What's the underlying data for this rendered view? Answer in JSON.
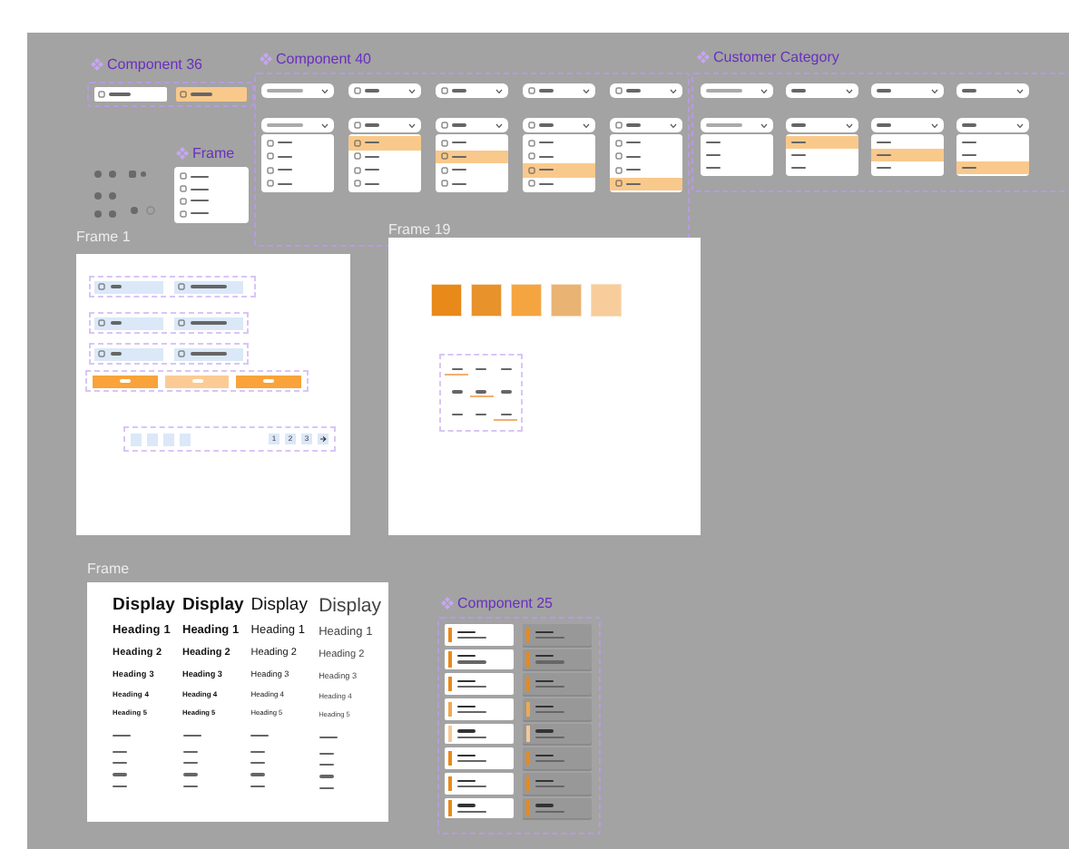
{
  "component_36": {
    "title": "Component 36",
    "buttons": [
      {
        "selected": false
      },
      {
        "selected": true
      }
    ]
  },
  "menu_frame": {
    "title": "Frame"
  },
  "component_40": {
    "title": "Component 40",
    "dropdowns": [
      {
        "options": [
          {
            "selected": false
          },
          {
            "selected": false
          },
          {
            "selected": false
          },
          {
            "selected": false
          }
        ]
      },
      {
        "options": [
          {
            "selected": true
          },
          {
            "selected": false
          },
          {
            "selected": false
          },
          {
            "selected": false
          }
        ]
      },
      {
        "options": [
          {
            "selected": false
          },
          {
            "selected": true
          },
          {
            "selected": false
          },
          {
            "selected": false
          }
        ]
      },
      {
        "options": [
          {
            "selected": false
          },
          {
            "selected": false
          },
          {
            "selected": true
          },
          {
            "selected": false
          }
        ]
      },
      {
        "options": [
          {
            "selected": false
          },
          {
            "selected": false
          },
          {
            "selected": false
          },
          {
            "selected": true
          }
        ]
      }
    ]
  },
  "customer_category": {
    "title": "Customer Category",
    "dropdowns": [
      {
        "options": [
          {
            "selected": false
          },
          {
            "selected": false
          },
          {
            "selected": false
          }
        ]
      },
      {
        "options": [
          {
            "selected": true
          },
          {
            "selected": false
          },
          {
            "selected": false
          }
        ]
      },
      {
        "options": [
          {
            "selected": false
          },
          {
            "selected": true
          },
          {
            "selected": false
          }
        ]
      },
      {
        "options": [
          {
            "selected": false
          },
          {
            "selected": false
          },
          {
            "selected": true
          }
        ]
      }
    ]
  },
  "frame_1": {
    "title": "Frame 1",
    "buttons": [
      {
        "disabled": false
      },
      {
        "disabled": true
      },
      {
        "disabled": false
      }
    ],
    "pages": [
      "1",
      "2",
      "3"
    ]
  },
  "frame_19": {
    "title": "Frame 19",
    "swatches": [
      {
        "color": "#e8891a"
      },
      {
        "color": "#e8922c"
      },
      {
        "color": "#f5a540"
      },
      {
        "color": "#e9b374"
      },
      {
        "color": "#f8cd9c"
      }
    ],
    "tab_rows": [
      {
        "tabs": [
          {
            "selected": true
          },
          {
            "selected": false
          },
          {
            "selected": false
          }
        ]
      },
      {
        "tabs": [
          {
            "selected": false
          },
          {
            "selected": true
          },
          {
            "selected": false
          }
        ]
      },
      {
        "tabs": [
          {
            "selected": false
          },
          {
            "selected": false
          },
          {
            "selected": true
          }
        ]
      }
    ]
  },
  "type_frame": {
    "title": "Frame",
    "columns": [
      {
        "kind": "heavy",
        "entries": [
          "Display",
          "Heading 1",
          "Heading 2",
          "Heading 3",
          "Heading 4",
          "Heading 5"
        ]
      },
      {
        "kind": "bold",
        "entries": [
          "Display",
          "Heading 1",
          "Heading 2",
          "Heading 3",
          "Heading 4",
          "Heading 5"
        ]
      },
      {
        "kind": "medium",
        "entries": [
          "Display",
          "Heading 1",
          "Heading 2",
          "Heading 3",
          "Heading 4",
          "Heading 5"
        ]
      },
      {
        "kind": "light",
        "entries": [
          "Display",
          "Heading 1",
          "Heading 2",
          "Heading 3",
          "Heading 4",
          "Heading 5"
        ]
      }
    ]
  },
  "component_25": {
    "title": "Component 25",
    "columns": [
      {
        "kind": "light",
        "cards": [
          {
            "color": "#e8891a"
          },
          {
            "color": "#e8891a"
          },
          {
            "color": "#e8891a"
          },
          {
            "color": "#f0a850"
          },
          {
            "color": "#f5c898"
          },
          {
            "color": "#e8891a"
          },
          {
            "color": "#e8891a"
          },
          {
            "color": "#e8891a"
          }
        ]
      },
      {
        "kind": "dark",
        "cards": [
          {
            "color": "#e8891a"
          },
          {
            "color": "#e8891a"
          },
          {
            "color": "#e8891a"
          },
          {
            "color": "#f0a850"
          },
          {
            "color": "#f5c898"
          },
          {
            "color": "#e8891a"
          },
          {
            "color": "#e8891a"
          },
          {
            "color": "#e8891a"
          }
        ]
      }
    ]
  }
}
